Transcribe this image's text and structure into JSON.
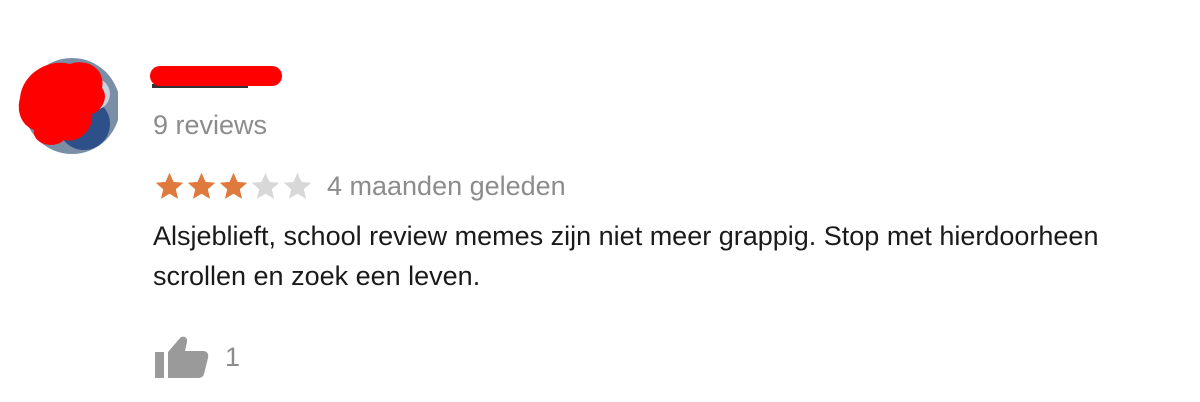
{
  "review": {
    "reviews_count": "9 reviews",
    "rating": 3,
    "rating_max": 5,
    "time_ago": "4 maanden geleden",
    "text": "Alsjeblieft, school review memes zijn niet meer grappig. Stop met hierdoorheen scrollen en zoek een leven.",
    "like_count": "1"
  },
  "colors": {
    "star_filled": "#e07a3c",
    "star_empty": "#d8d8d8",
    "redaction": "#ff0000",
    "muted_text": "#8c8c8c",
    "icon_gray": "#9a9a9a"
  },
  "icons": {
    "thumbs_up": "thumbs-up-icon",
    "star": "star-icon"
  }
}
